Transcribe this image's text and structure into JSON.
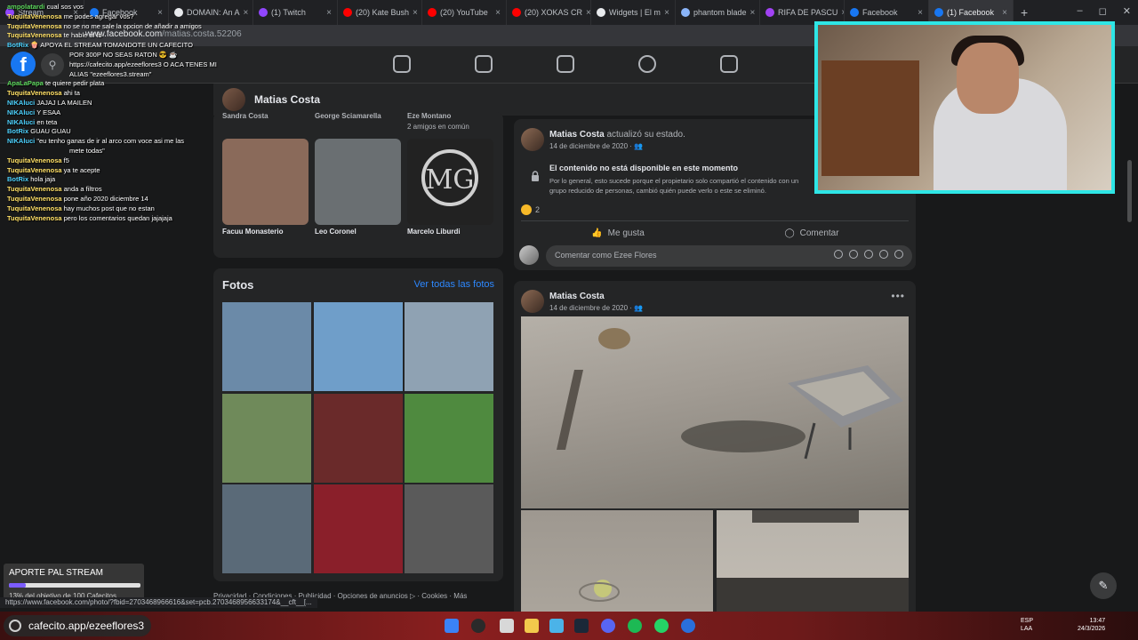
{
  "browser": {
    "tabs": [
      {
        "label": "Stream",
        "color": "#9146ff"
      },
      {
        "label": "Facebook",
        "color": "#1877f2"
      },
      {
        "label": "DOMAIN: An A",
        "color": "#e8eaed"
      },
      {
        "label": "(1) Twitch",
        "color": "#9146ff"
      },
      {
        "label": "(20) Kate Bush",
        "color": "#ff0000"
      },
      {
        "label": "(20) YouTube",
        "color": "#ff0000"
      },
      {
        "label": "(20) XOKAS CR",
        "color": "#ff0000"
      },
      {
        "label": "Widgets | El m",
        "color": "#e8eaed"
      },
      {
        "label": "phantom blade",
        "color": "#8ab4f8"
      },
      {
        "label": "RIFA DE PASCU",
        "color": "#a142f4"
      },
      {
        "label": "Facebook",
        "color": "#1877f2"
      },
      {
        "label": "(1) Facebook",
        "color": "#1877f2"
      }
    ],
    "url_host": "www.facebook.com",
    "url_path": "/matias.costa.52206"
  },
  "profile": {
    "name": "Matias Costa"
  },
  "friends": {
    "top_names": [
      "Sandra Costa",
      "George Sciamarella",
      "Eze Montano"
    ],
    "top_sub": "2 amigos en común",
    "tiles": [
      {
        "name": "Facuu Monasterio",
        "color": "#8a6a5a"
      },
      {
        "name": "Leo Coronel",
        "color": "#6a6f72"
      },
      {
        "name": "Marcelo Liburdi",
        "color": "#222222"
      }
    ]
  },
  "photos": {
    "title": "Fotos",
    "see_all": "Ver todas las fotos",
    "tiles": [
      "#6b8aa8",
      "#6f9ec9",
      "#8fa2b3",
      "#6f8a5a",
      "#6a2a2a",
      "#4f8a3f",
      "#5a6a78",
      "#8a1f2a",
      "#5a5a5a"
    ]
  },
  "footer": "Privacidad · Condiciones · Publicidad · Opciones de anuncios ▷ · Cookies · Más",
  "post1": {
    "author": "Matias Costa",
    "action": "actualizó su estado.",
    "date": "14 de diciembre de 2020 · ",
    "unavailable_title": "El contenido no está disponible en este momento",
    "unavailable_text": "Por lo general, esto sucede porque el propietario solo compartió el contenido con un grupo reducido de personas, cambió quién puede verlo o este se eliminó.",
    "reaction_count": "2",
    "like_label": "Me gusta",
    "comment_label": "Comentar",
    "comment_placeholder": "Comentar como Ezee Flores"
  },
  "post2": {
    "author": "Matias Costa",
    "date": "14 de diciembre de 2020 · "
  },
  "chat": [
    {
      "user": "ampolatardi",
      "msg": "cual sos vos",
      "color": "#5cd65c"
    },
    {
      "user": "TuquitaVenenosa",
      "msg": "me podes agregar vos?",
      "color": "#ffe066"
    },
    {
      "user": "TuquitaVenenosa",
      "msg": "no se no me sale la opcion de añadir a amigos",
      "color": "#ffe066"
    },
    {
      "user": "TuquitaVenenosa",
      "msg": "te hable al fb",
      "color": "#ffe066"
    },
    {
      "user": "BotRix",
      "msg": "🍿 APOYA EL STREAM TOMANDOTE UN CAFECITO",
      "color": "#4dd2ff"
    },
    {
      "user": "",
      "msg": "POR 300P NO SEAS RATON 😎 ☕",
      "color": "#ffffff"
    },
    {
      "user": "",
      "msg": "https://cafecito.app/ezeeflores3 O ACA TENES MI",
      "color": "#ffffff"
    },
    {
      "user": "",
      "msg": "ALIAS \"ezeeflores3.stream\"",
      "color": "#ffffff"
    },
    {
      "user": "ApaLaPapa",
      "msg": "te quiere pedir plata",
      "color": "#5cd65c"
    },
    {
      "user": "TuquitaVenenosa",
      "msg": "ahi ta",
      "color": "#ffe066"
    },
    {
      "user": "NIKAluci",
      "msg": "JAJAJ LA MAILEN",
      "color": "#4dd2ff"
    },
    {
      "user": "NIKAluci",
      "msg": "Y ESAA",
      "color": "#4dd2ff"
    },
    {
      "user": "NIKAluci",
      "msg": "en teta",
      "color": "#4dd2ff"
    },
    {
      "user": "BotRix",
      "msg": "GUAU GUAU",
      "color": "#4dd2ff"
    },
    {
      "user": "NIKAluci",
      "msg": "\"eu tenho ganas de ir al arco com voce asi me las",
      "color": "#4dd2ff"
    },
    {
      "user": "",
      "msg": "mete todas\"",
      "color": "#ffffff"
    },
    {
      "user": "TuquitaVenenosa",
      "msg": "f5",
      "color": "#ffe066"
    },
    {
      "user": "TuquitaVenenosa",
      "msg": "ya te acepte",
      "color": "#ffe066"
    },
    {
      "user": "BotRix",
      "msg": "hola jaja",
      "color": "#4dd2ff"
    },
    {
      "user": "TuquitaVenenosa",
      "msg": "anda a filtros",
      "color": "#ffe066"
    },
    {
      "user": "TuquitaVenenosa",
      "msg": "pone año 2020 diciembre 14",
      "color": "#ffe066"
    },
    {
      "user": "TuquitaVenenosa",
      "msg": "hay muchos post que no estan",
      "color": "#ffe066"
    },
    {
      "user": "TuquitaVenenosa",
      "msg": "pero los comentarios quedan jajajaja",
      "color": "#ffe066"
    }
  ],
  "donation": {
    "title": "APORTE PAL STREAM",
    "progress_fraction": 0.13,
    "text": "13% del objetivo de 100 Cafecitos"
  },
  "status_url": "https://www.facebook.com/photo/?fbid=270346896661​6&set=pcb.2703468956633174&__cft__[...",
  "taskbar": {
    "cafecito": "cafecito.app/ezeeflores3",
    "lang": "ESP\nLAA",
    "time": "13:47\n24/3/2026"
  }
}
